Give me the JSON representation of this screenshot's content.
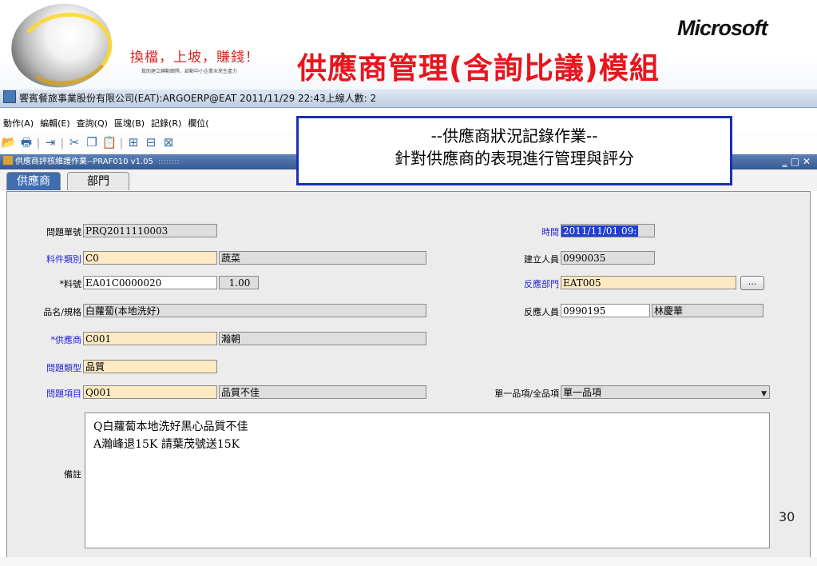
{
  "slide": {
    "slogan": "換檔，上坡，賺錢！",
    "slogan_sub": "幫助建立轉動團隊，啟動中小企業未來生產力",
    "title": "供應商管理(含詢比議)模組",
    "brand": "Microsoft",
    "callout_line1": "--供應商狀況記錄作業--",
    "callout_line2": "針對供應商的表現進行管理與評分",
    "page_number": "30"
  },
  "window": {
    "title": "饗賓餐旅事業股份有限公司(EAT):ARGOERP@EAT 2011/11/29 22:43上線人數: 2"
  },
  "menubar": {
    "items": [
      "動作(A)",
      "編輯(E)",
      "查詢(Q)",
      "區塊(B)",
      "記錄(R)",
      "欄位("
    ]
  },
  "toolbar": {
    "icons": [
      "open-folder-icon",
      "print-icon",
      "exit-icon",
      "cut-icon",
      "copy-icon",
      "paste-icon",
      "query-icon",
      "execute-query-icon",
      "clear-icon"
    ]
  },
  "form": {
    "title": "供應商評核維護作業--PRAF010 v1.05",
    "tabs": [
      "供應商",
      "部門"
    ],
    "fields": {
      "issue_no_label": "問題單號",
      "issue_no": "PRQ2011110003",
      "time_label": "時間",
      "time": "2011/11/01 09:",
      "material_type_label": "料件類別",
      "material_type": "C0",
      "material_type_name": "蔬菜",
      "creator_label": "建立人員",
      "creator": "0990035",
      "item_no_label": "*料號",
      "item_no": "EA01C0000020",
      "item_qty": "1.00",
      "dept_label": "反應部門",
      "dept": "EAT005",
      "dept_button": "...",
      "spec_label": "品名/規格",
      "spec": "白蘿蔔(本地洗好)",
      "reporter_label": "反應人員",
      "reporter": "0990195",
      "reporter_name": "林慶華",
      "supplier_label": "*供應商",
      "supplier": "C001",
      "supplier_name": "瀚朝",
      "issue_type_label": "問題類型",
      "issue_type": "品質",
      "issue_item_label": "問題項目",
      "issue_item": "Q001",
      "issue_item_name": "品質不佳",
      "scope_label": "單一品項/全品項",
      "scope": "單一品項",
      "memo_label": "備註",
      "memo_line1": "Q白蘿蔔本地洗好黑心品質不佳",
      "memo_line2": "A瀚峰退15K 請葉茂號送15K"
    }
  },
  "colors": {
    "title_red": "#e8151d",
    "callout_border": "#1c2fb5",
    "required_label_blue": "#2323d9",
    "tab_active": "#3f6db0",
    "field_yellow": "#fde9c3"
  }
}
